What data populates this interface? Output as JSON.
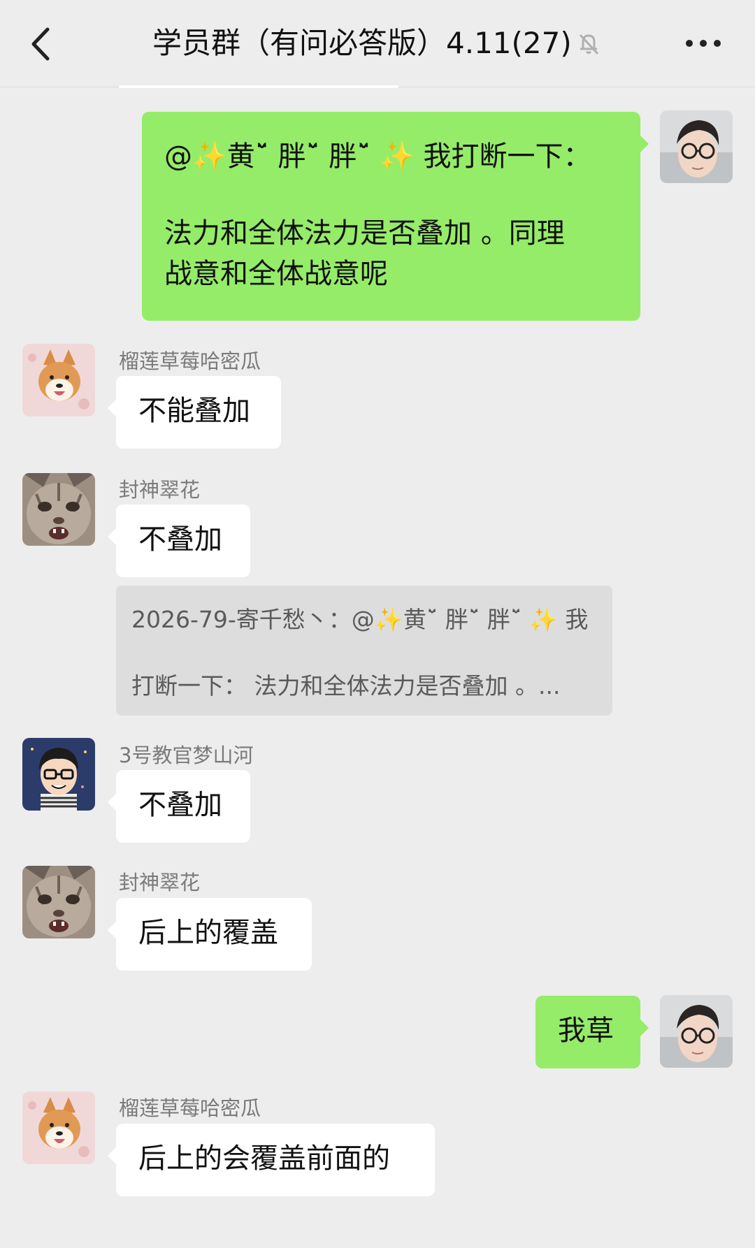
{
  "header": {
    "title": "学员群（有问必答版）4.11(27)",
    "back_icon": "chevron-left-icon",
    "mute_icon": "bell-off-icon",
    "more_icon": "more-dots-icon"
  },
  "colors": {
    "background": "#ededed",
    "outgoing_bubble": "#95ec69",
    "incoming_bubble": "#ffffff",
    "quote_bg": "#dddddd"
  },
  "messages": [
    {
      "direction": "outgoing",
      "avatar": "glasses-man-photo",
      "line1": "@✨黄ˇ̈ 胖ˇ̈ 胖ˇ̈ ✨ 我打断一下：",
      "line2": "法力和全体法力是否叠加 。同理",
      "line3": "战意和全体战意呢"
    },
    {
      "direction": "incoming",
      "sender": "榴莲草莓哈密瓜",
      "avatar": "shiba-dog-photo",
      "text": "不能叠加"
    },
    {
      "direction": "incoming",
      "sender": "封神翠花",
      "avatar": "cat-face-photo",
      "text": "不叠加",
      "quote_line1": "2026-79-寄千愁丶：@✨黄ˇ̈ 胖ˇ̈ 胖ˇ̈ ✨ 我",
      "quote_line2": "打断一下：  法力和全体法力是否叠加 。..."
    },
    {
      "direction": "incoming",
      "sender": "3号教官梦山河",
      "avatar": "cartoon-man-avatar",
      "text": "不叠加"
    },
    {
      "direction": "incoming",
      "sender": "封神翠花",
      "avatar": "cat-face-photo",
      "text": "后上的覆盖"
    },
    {
      "direction": "outgoing",
      "avatar": "glasses-man-photo",
      "text": "我草"
    },
    {
      "direction": "incoming",
      "sender": "榴莲草莓哈密瓜",
      "avatar": "shiba-dog-photo",
      "text": "后上的会覆盖前面的"
    }
  ]
}
